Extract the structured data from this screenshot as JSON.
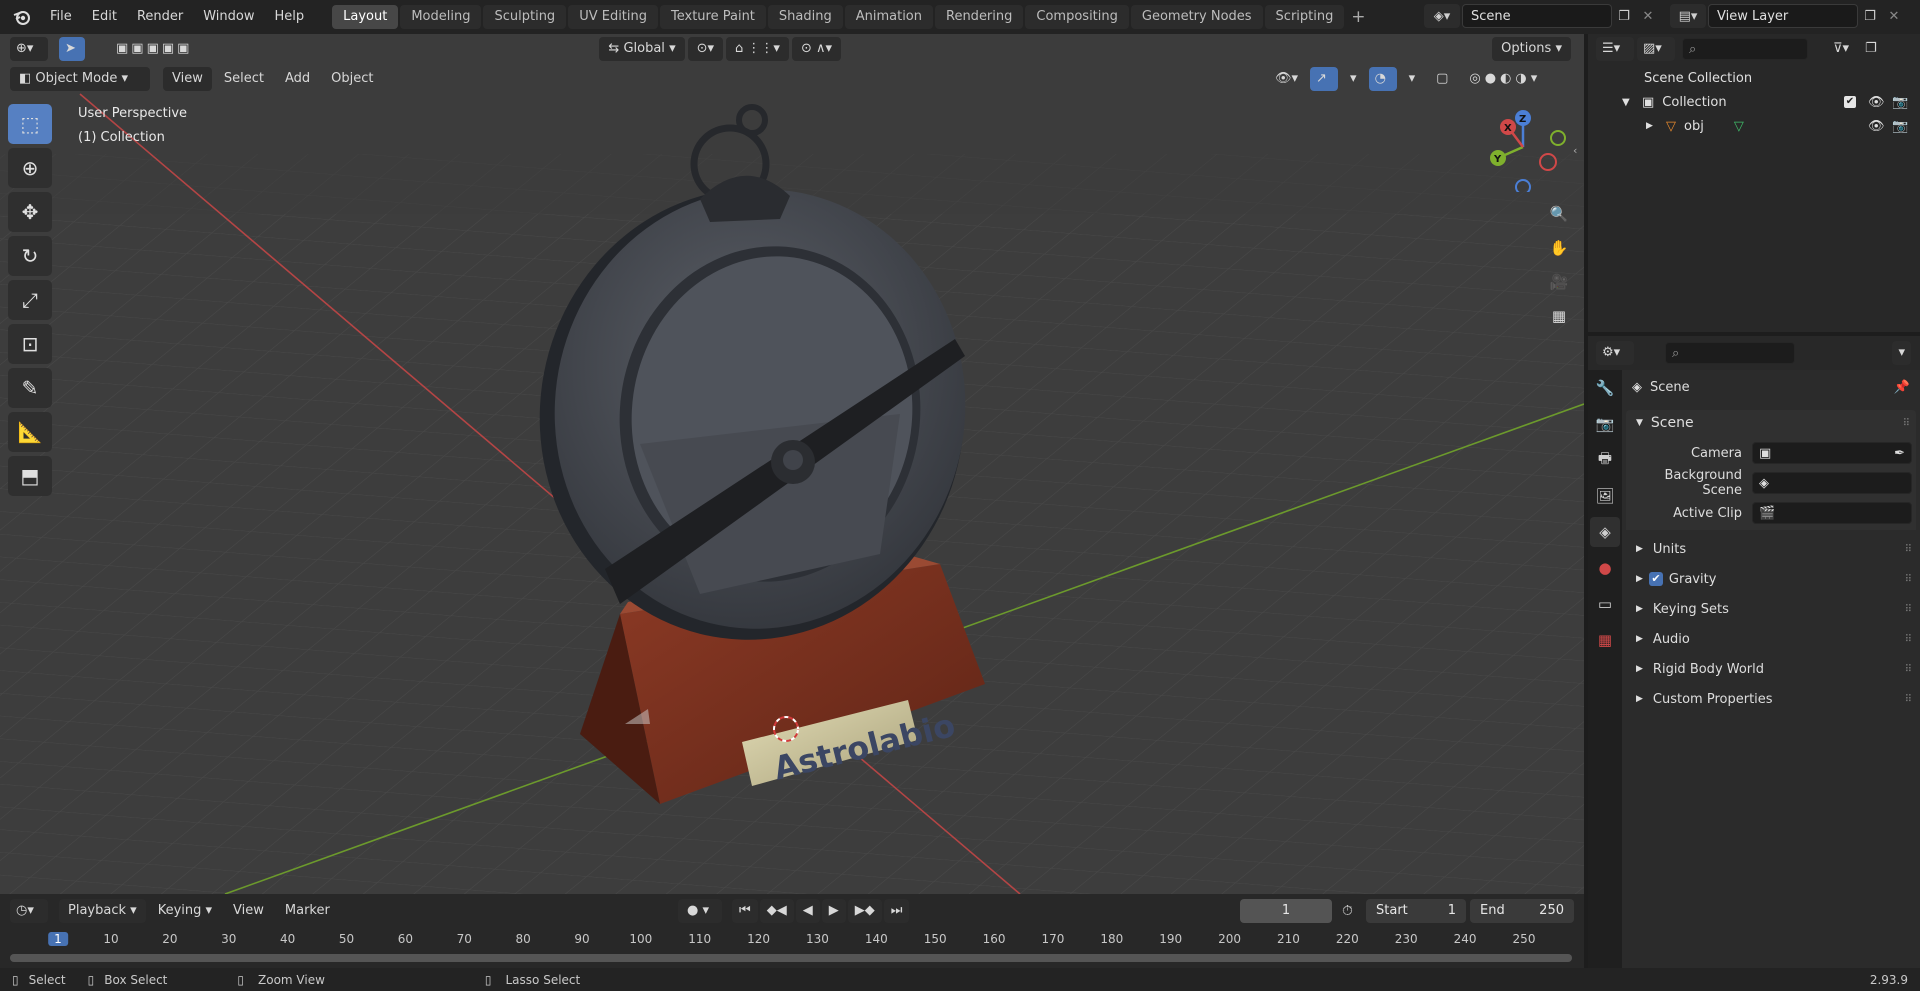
{
  "topbar": {
    "menus": [
      "File",
      "Edit",
      "Render",
      "Window",
      "Help"
    ],
    "workspaces": [
      "Layout",
      "Modeling",
      "Sculpting",
      "UV Editing",
      "Texture Paint",
      "Shading",
      "Animation",
      "Rendering",
      "Compositing",
      "Geometry Nodes",
      "Scripting"
    ],
    "active_workspace": "Layout",
    "add_tab": "+",
    "scene_name": "Scene",
    "view_layer_name": "View Layer"
  },
  "viewport": {
    "orientation": "Global",
    "options_label": "Options",
    "mode": "Object Mode",
    "menus": [
      "View",
      "Select",
      "Add",
      "Object"
    ],
    "overlay_line1": "User Perspective",
    "overlay_line2": "(1) Collection",
    "nameplate_text": "Astrolabio",
    "gizmo": {
      "x": "X",
      "y": "Y",
      "z": "Z"
    },
    "colors": {
      "background": "#3d3d3d",
      "grid": "#4a4a4a",
      "x_axis": "#b44545",
      "y_axis": "#6c9a2c",
      "accent": "#4772b3"
    }
  },
  "timeline": {
    "menus": [
      "Playback",
      "Keying",
      "View",
      "Marker"
    ],
    "current_frame": "1",
    "start_label": "Start",
    "start_value": "1",
    "end_label": "End",
    "end_value": "250",
    "ruler_ticks": [
      "1",
      "10",
      "20",
      "30",
      "40",
      "50",
      "60",
      "70",
      "80",
      "90",
      "100",
      "110",
      "120",
      "130",
      "140",
      "150",
      "160",
      "170",
      "180",
      "190",
      "200",
      "210",
      "220",
      "230",
      "240",
      "250"
    ]
  },
  "statusbar": {
    "select": "Select",
    "box_select": "Box Select",
    "zoom_view": "Zoom View",
    "lasso_select": "Lasso Select",
    "version": "2.93.9"
  },
  "outliner": {
    "root": "Scene Collection",
    "collection": "Collection",
    "object": "obj"
  },
  "properties": {
    "context": "Scene",
    "panel_title": "Scene",
    "camera_label": "Camera",
    "background_scene_label": "Background Scene",
    "active_clip_label": "Active Clip",
    "sections": [
      "Units",
      "Gravity",
      "Keying Sets",
      "Audio",
      "Rigid Body World",
      "Custom Properties"
    ],
    "gravity_enabled": true
  }
}
